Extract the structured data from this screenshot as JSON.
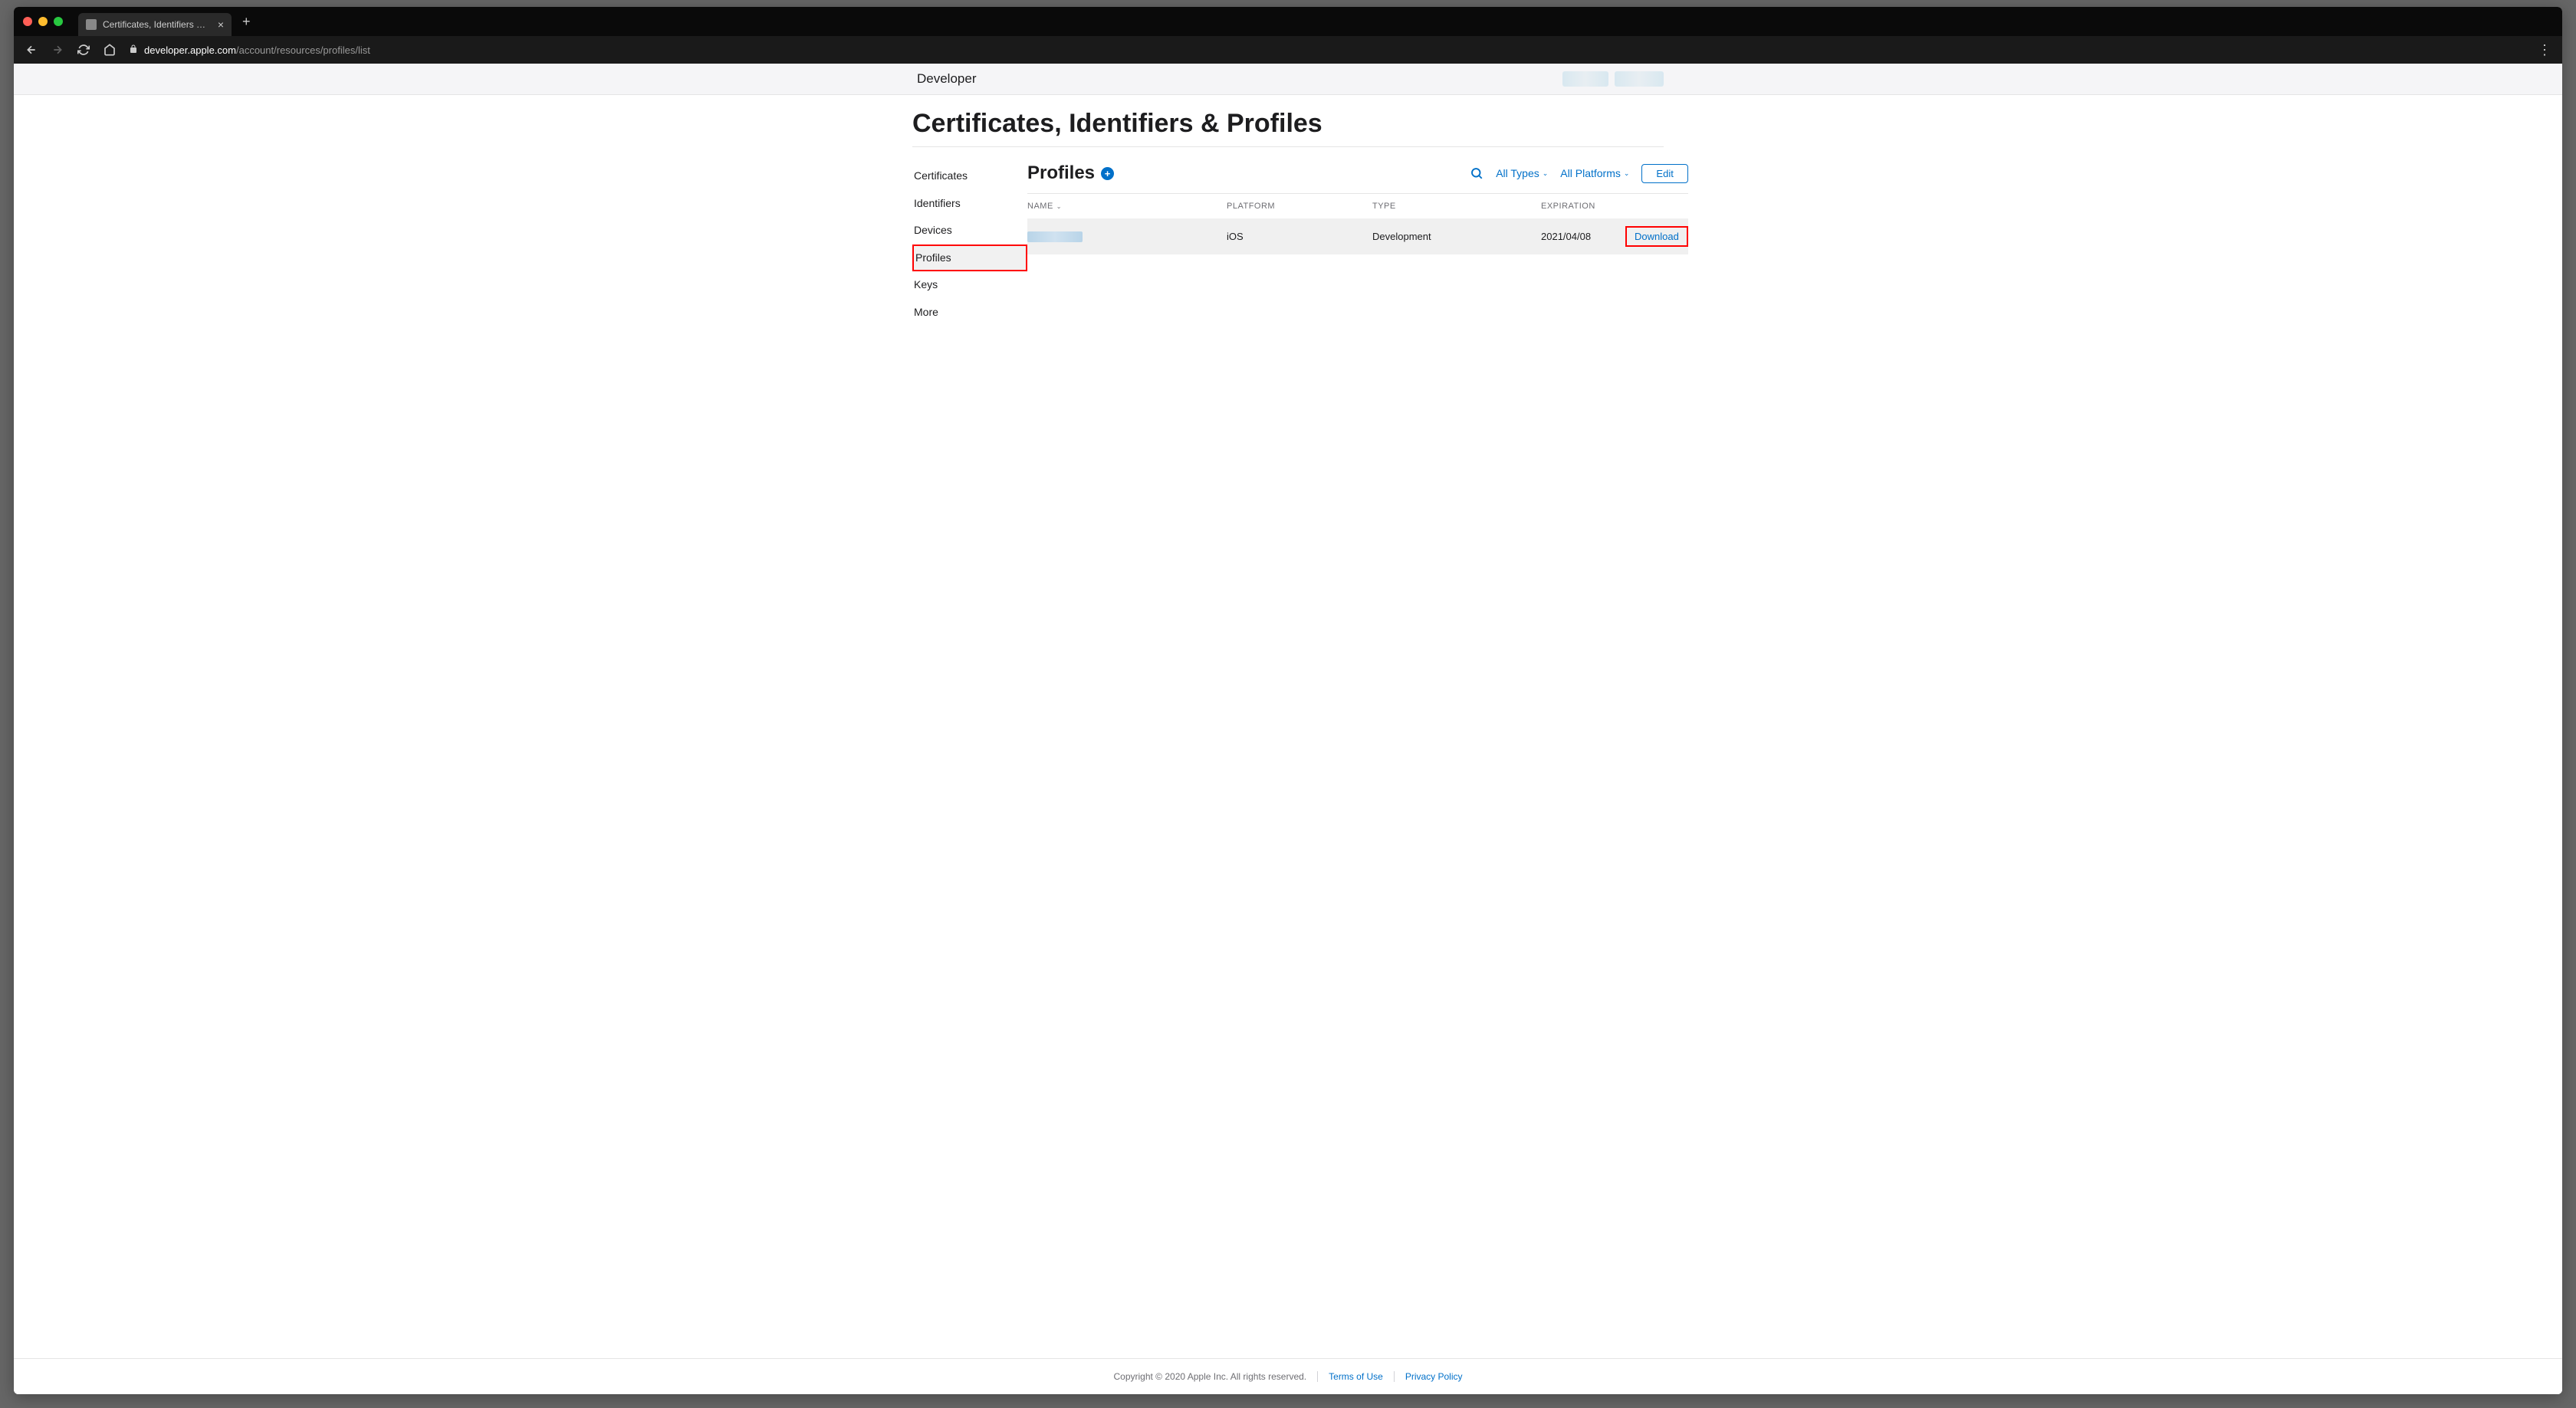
{
  "browser": {
    "tab_title": "Certificates, Identifiers & Profiles",
    "url_domain": "developer.apple.com",
    "url_path": "/account/resources/profiles/list"
  },
  "header": {
    "brand": "Developer"
  },
  "page": {
    "title": "Certificates, Identifiers & Profiles"
  },
  "sidebar": {
    "items": [
      {
        "label": "Certificates"
      },
      {
        "label": "Identifiers"
      },
      {
        "label": "Devices"
      },
      {
        "label": "Profiles"
      },
      {
        "label": "Keys"
      },
      {
        "label": "More"
      }
    ]
  },
  "panel": {
    "title": "Profiles",
    "filter_types": "All Types",
    "filter_platforms": "All Platforms",
    "edit": "Edit"
  },
  "table": {
    "headers": {
      "name": "NAME",
      "platform": "PLATFORM",
      "type": "TYPE",
      "expiration": "EXPIRATION"
    },
    "rows": [
      {
        "platform": "iOS",
        "type": "Development",
        "expiration": "2021/04/08",
        "action": "Download"
      }
    ]
  },
  "footer": {
    "copyright": "Copyright © 2020 Apple Inc. All rights reserved.",
    "terms": "Terms of Use",
    "privacy": "Privacy Policy"
  }
}
